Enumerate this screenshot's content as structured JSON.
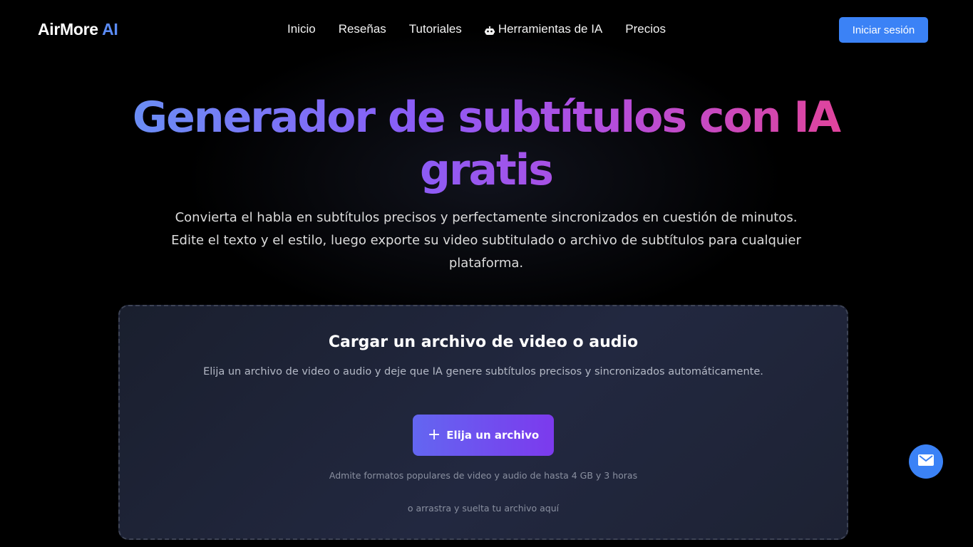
{
  "header": {
    "logo_main": "AirMore",
    "logo_accent": "AI",
    "nav": [
      {
        "label": "Inicio"
      },
      {
        "label": "Reseñas"
      },
      {
        "label": "Tutoriales"
      },
      {
        "label": "Herramientas de IA",
        "icon": "robot-icon"
      },
      {
        "label": "Precios"
      }
    ],
    "login_label": "Iniciar sesión"
  },
  "hero": {
    "title": "Generador de subtítulos con IA gratis",
    "subtitle": "Convierta el habla en subtítulos precisos y perfectamente sincronizados en cuestión de minutos. Edite el texto y el estilo, luego exporte su video subtitulado o archivo de subtítulos para cualquier plataforma."
  },
  "upload": {
    "title": "Cargar un archivo de video o audio",
    "description": "Elija un archivo de video o audio y deje que IA genere subtítulos precisos y sincronizados automáticamente.",
    "button_label": "Elija un archivo",
    "button_icon": "plus-icon",
    "formats": "Admite formatos populares de video y audio de hasta 4 GB y 3 horas",
    "drag_hint": "o arrastra y suelta tu archivo aquí"
  },
  "fab": {
    "icon": "mail-icon"
  },
  "colors": {
    "accent": "#3b82f6",
    "title_gradient": [
      "#6a8ef5",
      "#8b5cf6",
      "#b14ee0",
      "#e0449c"
    ],
    "button_gradient": [
      "#6366f1",
      "#7c3aed"
    ]
  }
}
